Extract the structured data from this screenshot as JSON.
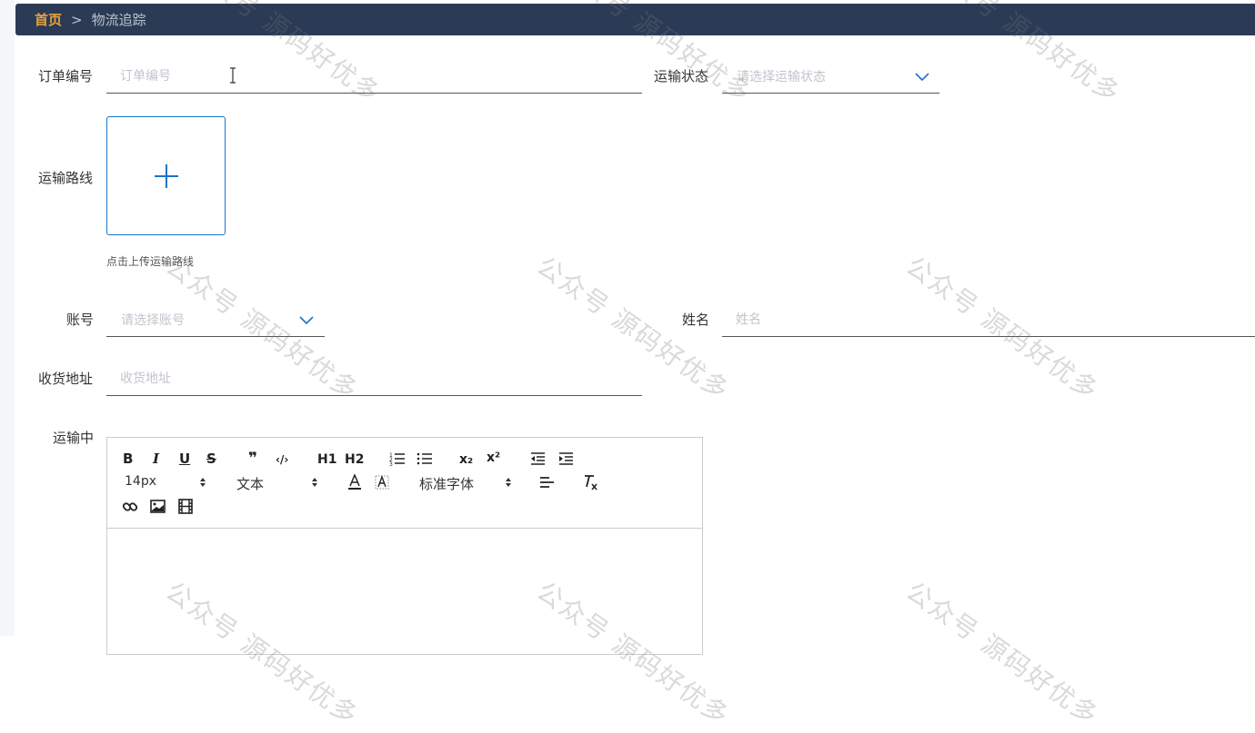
{
  "breadcrumb": {
    "home": "首页",
    "separator": ">",
    "current": "物流追踪"
  },
  "form": {
    "order_no": {
      "label": "订单编号",
      "placeholder": "订单编号"
    },
    "status": {
      "label": "运输状态",
      "placeholder": "请选择运输状态"
    },
    "route": {
      "label": "运输路线",
      "upload_tip": "点击上传运输路线"
    },
    "account": {
      "label": "账号",
      "placeholder": "请选择账号"
    },
    "name": {
      "label": "姓名",
      "placeholder": "姓名"
    },
    "address": {
      "label": "收货地址",
      "placeholder": "收货地址"
    },
    "transit": {
      "label": "运输中"
    }
  },
  "editor": {
    "toolbar": {
      "bold": "B",
      "italic": "I",
      "underline": "U",
      "strike": "S",
      "quote": "❞",
      "code": "‹/›",
      "h1": "H1",
      "h2": "H2",
      "subscript": "x₂",
      "superscript": "x²",
      "size": "14px",
      "header": "文本",
      "font": "标准字体"
    }
  },
  "watermark_text": "公众号 源码好优多",
  "colors": {
    "header_bg": "#2c3b55",
    "home_accent": "#e8a33d",
    "primary": "#1a73c8"
  }
}
